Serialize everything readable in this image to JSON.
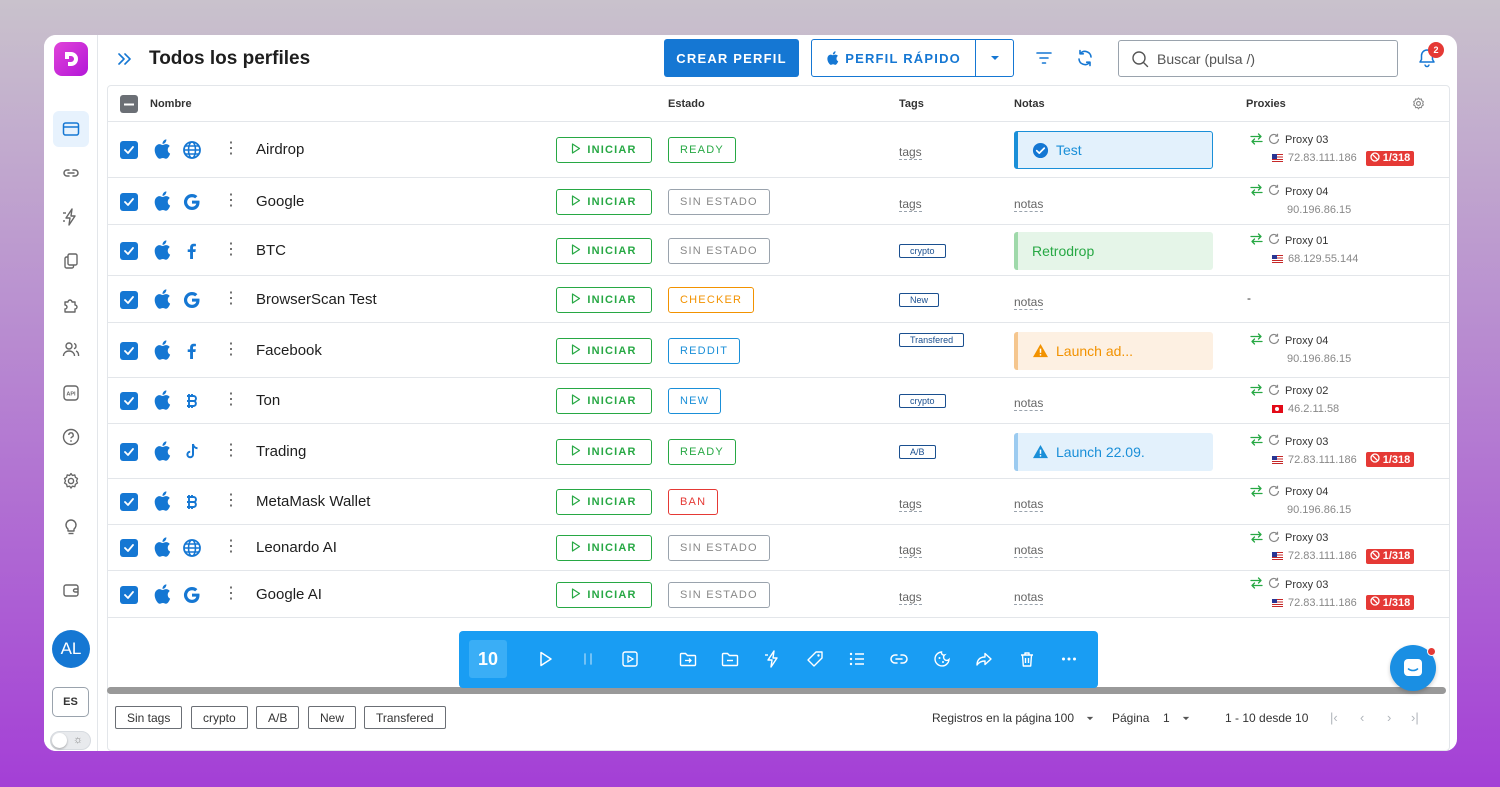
{
  "header": {
    "title": "Todos los perfiles",
    "create_label": "CREAR PERFIL",
    "quick_label": "PERFIL RÁPIDO",
    "search_placeholder": "Buscar (pulsa /)",
    "notif_count": "2"
  },
  "sidebar": {
    "avatar": "AL",
    "lang": "ES",
    "items": [
      "profiles-icon",
      "link-icon",
      "automation-icon",
      "copy-icon",
      "extension-icon",
      "team-icon",
      "api-icon",
      "help-icon",
      "settings-icon",
      "idea-icon",
      "wallet-icon"
    ]
  },
  "table": {
    "headers": {
      "name": "Nombre",
      "status": "Estado",
      "tags": "Tags",
      "notes": "Notas",
      "proxies": "Proxies"
    },
    "start_label": "INICIAR",
    "empty_tags": "tags",
    "empty_notes": "notas",
    "rows": [
      {
        "name": "Airdrop",
        "site": "globe",
        "status": "READY",
        "status_type": "ready",
        "tag": "",
        "note": "Test",
        "note_type": "blue-b",
        "note_icon": "check",
        "proxy": "Proxy 03",
        "ip": "72.83.111.186",
        "flag": "us",
        "limit": "1/318"
      },
      {
        "name": "Google",
        "site": "google",
        "status": "SIN ESTADO",
        "status_type": "sin",
        "tag": "",
        "note": "",
        "note_type": "",
        "note_icon": "",
        "proxy": "Proxy 04",
        "ip": "90.196.86.15",
        "flag": "",
        "limit": ""
      },
      {
        "name": "BTC",
        "site": "facebook",
        "status": "SIN ESTADO",
        "status_type": "sin",
        "tag": "crypto",
        "note": "Retrodrop",
        "note_type": "green",
        "note_icon": "",
        "proxy": "Proxy 01",
        "ip": "68.129.55.144",
        "flag": "us",
        "limit": ""
      },
      {
        "name": "BrowserScan Test",
        "site": "google",
        "status": "CHECKER",
        "status_type": "checker",
        "tag": "New",
        "note": "",
        "note_type": "",
        "note_icon": "",
        "proxy": "-",
        "ip": "",
        "flag": "",
        "limit": ""
      },
      {
        "name": "Facebook",
        "site": "facebook",
        "status": "REDDIT",
        "status_type": "reddit",
        "tag": "Transfered",
        "note": "Launch ad...",
        "note_type": "orange",
        "note_icon": "warn",
        "proxy": "Proxy 04",
        "ip": "90.196.86.15",
        "flag": "",
        "limit": ""
      },
      {
        "name": "Ton",
        "site": "bitcoin",
        "status": "NEW",
        "status_type": "new",
        "tag": "crypto",
        "note": "",
        "note_type": "",
        "note_icon": "",
        "proxy": "Proxy 02",
        "ip": "46.2.11.58",
        "flag": "tr",
        "limit": ""
      },
      {
        "name": "Trading",
        "site": "tiktok",
        "status": "READY",
        "status_type": "ready",
        "tag": "A/B",
        "note": "Launch 22.09.",
        "note_type": "blue",
        "note_icon": "warn-blue",
        "proxy": "Proxy 03",
        "ip": "72.83.111.186",
        "flag": "us",
        "limit": "1/318"
      },
      {
        "name": "MetaMask Wallet",
        "site": "bitcoin",
        "status": "BAN",
        "status_type": "ban",
        "tag": "",
        "note": "",
        "note_type": "",
        "note_icon": "",
        "proxy": "Proxy 04",
        "ip": "90.196.86.15",
        "flag": "",
        "limit": ""
      },
      {
        "name": "Leonardo AI",
        "site": "globe",
        "status": "SIN ESTADO",
        "status_type": "sin",
        "tag": "",
        "note": "",
        "note_type": "",
        "note_icon": "",
        "proxy": "Proxy 03",
        "ip": "72.83.111.186",
        "flag": "us",
        "limit": "1/318"
      },
      {
        "name": "Google AI",
        "site": "google",
        "status": "SIN ESTADO",
        "status_type": "sin",
        "tag": "",
        "note": "",
        "note_type": "",
        "note_icon": "",
        "proxy": "Proxy 03",
        "ip": "72.83.111.186",
        "flag": "us",
        "limit": "1/318"
      }
    ]
  },
  "actionbar": {
    "selected_count": "10",
    "icons": [
      "play-icon",
      "pause-icon",
      "screen-icon",
      "move-folder-icon",
      "remove-folder-icon",
      "automation-icon",
      "tag-icon",
      "list-icon",
      "link-icon",
      "cookie-icon",
      "share-icon",
      "trash-icon",
      "more-icon"
    ]
  },
  "footer": {
    "tags": [
      "Sin tags",
      "crypto",
      "A/B",
      "New",
      "Transfered"
    ],
    "per_page_label": "Registros en la página",
    "per_page": "100",
    "page_label": "Página",
    "page": "1",
    "range": "1 - 10 desde 10"
  },
  "colors": {
    "primary": "#1577d3",
    "green": "#27a844",
    "orange": "#f29200",
    "red": "#e53935",
    "action_bar": "#199df3"
  }
}
